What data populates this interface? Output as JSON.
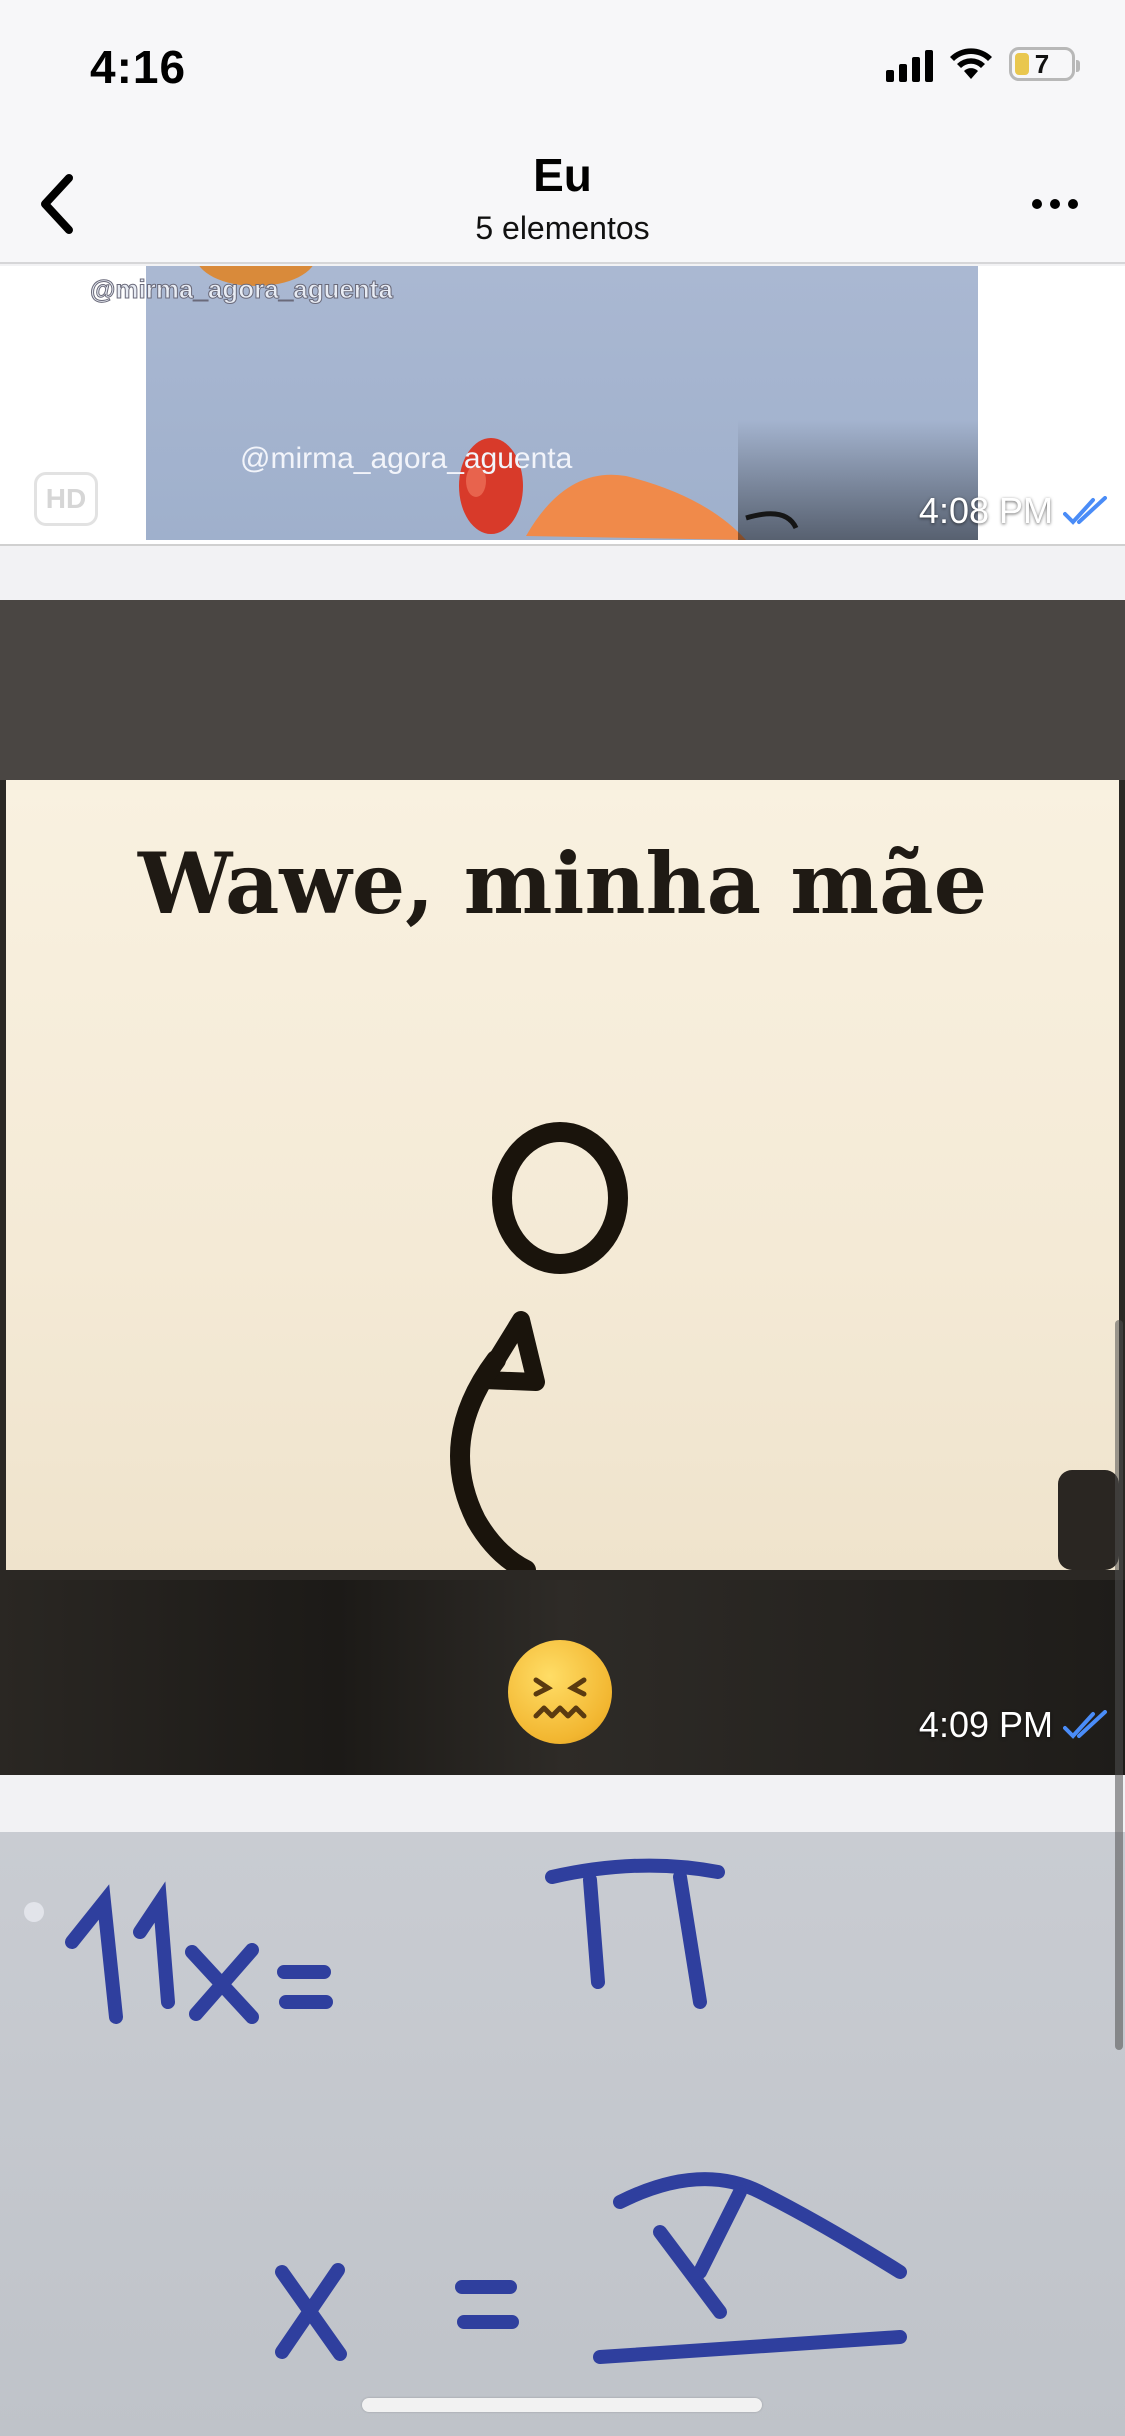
{
  "status_bar": {
    "time": "4:16",
    "battery": "7",
    "icons": [
      "cellular-signal-icon",
      "wifi-icon",
      "battery-icon"
    ]
  },
  "header": {
    "back_icon": "chevron-left-icon",
    "title": "Eu",
    "subtitle": "5 elementos",
    "more_icon": "more-horizontal-icon"
  },
  "media": [
    {
      "watermark_top": "@mirma_agora_aguenta",
      "watermark_mid": "@mirma_agora_aguenta",
      "badge": "HD",
      "time": "4:08 PM",
      "status_icon": "double-check-icon"
    },
    {
      "caption": "Wawe, minha mãe",
      "emoji": "confounded-face",
      "time": "4:09 PM",
      "status_icon": "double-check-icon"
    },
    {
      "handwriting_line1": "11x = π",
      "handwriting_line2": "x = π"
    }
  ],
  "colors": {
    "read_receipt": "#4a8cf7",
    "header_bg": "#f7f7f9",
    "battery_fill": "#e9c74f"
  }
}
